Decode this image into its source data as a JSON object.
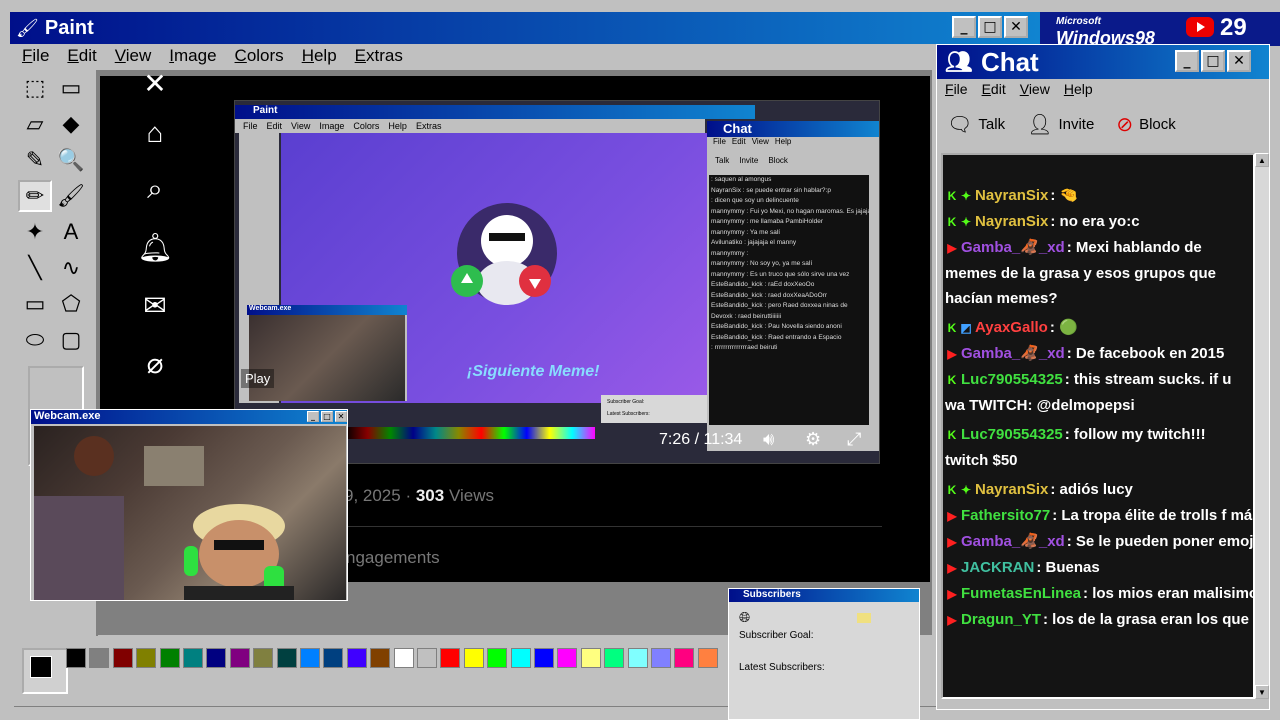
{
  "paint": {
    "title": "Paint",
    "menu": [
      "File",
      "Edit",
      "View",
      "Image",
      "Colors",
      "Help",
      "Extras"
    ]
  },
  "tools": [
    {
      "name": "free-select-icon",
      "glyph": "⬚"
    },
    {
      "name": "rect-select-icon",
      "glyph": "▭"
    },
    {
      "name": "eraser-icon",
      "glyph": "▱"
    },
    {
      "name": "fill-icon",
      "glyph": "◆"
    },
    {
      "name": "color-picker-icon",
      "glyph": "✎"
    },
    {
      "name": "magnifier-icon",
      "glyph": "🔍"
    },
    {
      "name": "pencil-icon",
      "glyph": "✏"
    },
    {
      "name": "brush-icon",
      "glyph": "🖌"
    },
    {
      "name": "airbrush-icon",
      "glyph": "✦"
    },
    {
      "name": "text-icon",
      "glyph": "A"
    },
    {
      "name": "line-icon",
      "glyph": "╲"
    },
    {
      "name": "curve-icon",
      "glyph": "∿"
    },
    {
      "name": "rectangle-icon",
      "glyph": "▭"
    },
    {
      "name": "polygon-icon",
      "glyph": "⬠"
    },
    {
      "name": "ellipse-icon",
      "glyph": "⬭"
    },
    {
      "name": "rounded-rect-icon",
      "glyph": "▢"
    }
  ],
  "xpost": {
    "date_fragment": "9, 2025 ·",
    "views_count": "303",
    "views_label": "Views",
    "engagements": "ngagements"
  },
  "video": {
    "paint_title": "Paint",
    "menu": [
      "File",
      "Edit",
      "View",
      "Image",
      "Colors",
      "Help",
      "Extras"
    ],
    "meme_text": "¡Siguiente Meme!",
    "play_label": "Play",
    "time": "7:26 / 11:34",
    "webcam_title": "Webcam.exe",
    "chat_title": "Chat",
    "chat_menu": [
      "File",
      "Edit",
      "View",
      "Help"
    ],
    "chat_toolbar": [
      "Talk",
      "Invite",
      "Block"
    ],
    "subs_goal": "Subscriber Goal:",
    "subs_latest": "Latest Subscribers:",
    "chat_lines": [
      ": saquen al amongus",
      "NayranSix : se puede entrar sin hablar?:p",
      ": dicen que soy un delincuente",
      "mannymmy : Fui yo Mexi, no hagan maromas. Es jajajajajajaja",
      "mannymmy : me llamaba PambiHolder",
      "mannymmy : Ya me salí",
      "Avilunatiko : jajajaja el manny",
      "mannymmy :",
      "mannymmy : No soy yo, ya me salí",
      "mannymmy : Es un truco que sólo sirve una vez",
      "EsteBandido_kick : raEd doxXeoOo",
      "EsteBandido_kick : raed doxXeaADoOrr",
      "EsteBandido_kick : pero Raed doxxea ninas de",
      "Devoxk : raed beiruttiiiiiii",
      "EsteBandido_kick : Pau Novella siendo anoni",
      "EsteBandido_kick : Raed entrando a Espacio",
      ": rrrrrrrrrrrrrrraed beiruti"
    ]
  },
  "webcam": {
    "title": "Webcam.exe"
  },
  "palette": {
    "colors": [
      "#000000",
      "#808080",
      "#800000",
      "#808000",
      "#008000",
      "#008080",
      "#000080",
      "#800080",
      "#808040",
      "#004040",
      "#0080ff",
      "#004080",
      "#4000ff",
      "#804000",
      "#ffffff",
      "#c0c0c0",
      "#ff0000",
      "#ffff00",
      "#00ff00",
      "#00ffff",
      "#0000ff",
      "#ff00ff",
      "#ffff80",
      "#00ff80",
      "#80ffff",
      "#8080ff",
      "#ff0080",
      "#ff8040"
    ]
  },
  "subscribers": {
    "title": "Subscribers",
    "goal_label": "Subscriber Goal:",
    "latest_label": "Latest Subscribers:"
  },
  "branding": {
    "os_top": "Microsoft",
    "os_name": "Windows98",
    "yt_count": "29"
  },
  "chat": {
    "title": "Chat",
    "menu": [
      "File",
      "Edit",
      "View",
      "Help"
    ],
    "toolbar": [
      {
        "label": "Talk",
        "icon": "talk-icon"
      },
      {
        "label": "Invite",
        "icon": "invite-icon"
      },
      {
        "label": "Block",
        "icon": "block-icon"
      }
    ],
    "messages": [
      {
        "platform": "kick",
        "badge": "✦",
        "name": "NayranSix",
        "color": "#e0c040",
        "text": ": 🤏",
        "wrap": false
      },
      {
        "platform": "kick",
        "badge": "✦",
        "name": "NayranSix",
        "color": "#e0c040",
        "text": ": no era yo:c",
        "wrap": false
      },
      {
        "platform": "youtube",
        "badge": "",
        "name": "Gamba_🦧_xd",
        "color": "#a050e0",
        "text": ": Mexi hablando de memes de la grasa y esos grupos que hacían memes?",
        "wrap": true
      },
      {
        "platform": "kick",
        "badge": "◩",
        "name": "AyaxGallo",
        "color": "#ff4040",
        "text": ": 🟢",
        "wrap": false
      },
      {
        "platform": "youtube",
        "badge": "",
        "name": "Gamba_🦧_xd",
        "color": "#a050e0",
        "text": ": De facebook en 2015",
        "wrap": false
      },
      {
        "platform": "kick",
        "badge": "",
        "name": "Luc790554325",
        "color": "#40e040",
        "text": ": this stream sucks. if u wa TWITCH: @delmopepsi",
        "wrap": true
      },
      {
        "platform": "kick",
        "badge": "",
        "name": "Luc790554325",
        "color": "#40e040",
        "text": ": follow my twitch!!! twitch $50",
        "wrap": true
      },
      {
        "platform": "kick",
        "badge": "✦",
        "name": "NayranSix",
        "color": "#e0c040",
        "text": ": adiós lucy",
        "wrap": false
      },
      {
        "platform": "youtube",
        "badge": "",
        "name": "Fathersito77",
        "color": "#40e040",
        "text": ": La tropa élite de trolls f más",
        "wrap": false
      },
      {
        "platform": "youtube",
        "badge": "",
        "name": "Gamba_🦧_xd",
        "color": "#a050e0",
        "text": ": Se le pueden poner emojis",
        "wrap": false
      },
      {
        "platform": "youtube",
        "badge": "",
        "name": "JACKRAN",
        "color": "#40c0a0",
        "text": ": Buenas",
        "wrap": false
      },
      {
        "platform": "youtube",
        "badge": "",
        "name": "FumetasEnLinea",
        "color": "#40e040",
        "text": ": los mios eran malisimos",
        "wrap": false
      },
      {
        "platform": "youtube",
        "badge": "",
        "name": "Dragun_YT",
        "color": "#40e040",
        "text": ": los de la grasa eran los que pon",
        "wrap": false
      }
    ]
  }
}
